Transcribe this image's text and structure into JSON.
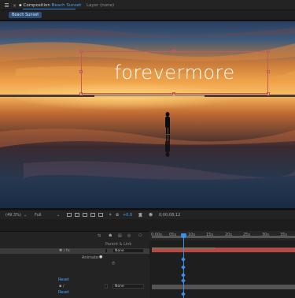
{
  "panel_tabs": {
    "comp_prefix": "Composition",
    "comp_name": "Beach Sunset",
    "layer_tab": "Layer (none)"
  },
  "comp_chip": "Beach Sunset",
  "viewer": {
    "title_text": "forevermore"
  },
  "viewer_toolbar": {
    "zoom": "(49.3%)",
    "resolution": "Full",
    "exposure": "+0.0",
    "timecode": "0;00;08;12"
  },
  "timeline": {
    "parent_link_label": "Parent & Link",
    "parent_value_1": "None",
    "parent_value_2": "None",
    "animate_label": "Animate:",
    "reset_1": "Reset",
    "reset_2": "Reset",
    "ruler_labels": [
      "0:00s",
      "05s",
      "10s",
      "15s",
      "20s",
      "25s",
      "30s",
      "35s"
    ]
  },
  "colors": {
    "accent": "#3a8ee6",
    "layer_bar": "#b34a4a",
    "bbox": "#c45a5a"
  }
}
